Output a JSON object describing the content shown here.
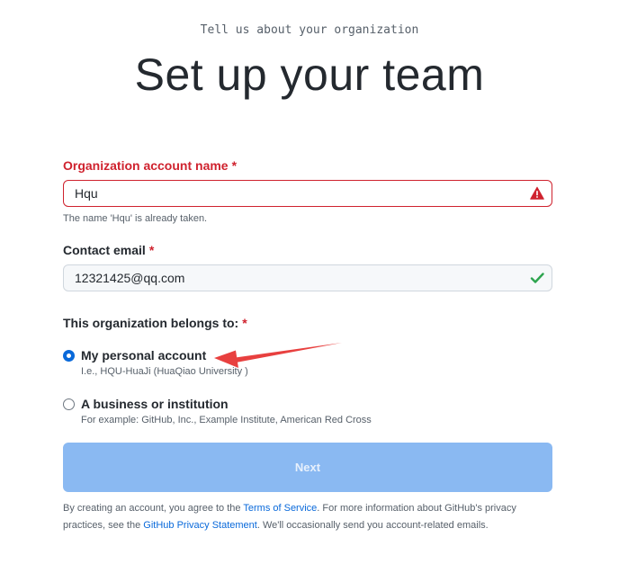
{
  "header": {
    "kicker": "Tell us about your organization",
    "title": "Set up your team"
  },
  "org_name": {
    "label": "Organization account name",
    "required_mark": "*",
    "value": "Hqu",
    "error": "The name 'Hqu' is already taken.",
    "status_icon": "alert-icon"
  },
  "contact_email": {
    "label": "Contact email",
    "required_mark": "*",
    "value": "12321425@qq.com",
    "status_icon": "check-icon"
  },
  "belongs_to": {
    "label": "This organization belongs to:",
    "required_mark": "*",
    "options": [
      {
        "title": "My personal account",
        "desc": "I.e., HQU-HuaJi (HuaQiao University )",
        "selected": true
      },
      {
        "title": "A business or institution",
        "desc": "For example: GitHub, Inc., Example Institute, American Red Cross",
        "selected": false
      }
    ]
  },
  "next_button": {
    "label": "Next"
  },
  "legal": {
    "prefix": "By creating an account, you agree to the ",
    "terms_link": "Terms of Service",
    "middle": ". For more information about GitHub's privacy practices, see the ",
    "privacy_link": "GitHub Privacy Statement",
    "suffix": ". We'll occasionally send you account-related emails."
  },
  "colors": {
    "error": "#cf222e",
    "success": "#2da44e",
    "link": "#0969da",
    "button_disabled": "#8ab9f2",
    "annotation_arrow": "#e8403f"
  }
}
